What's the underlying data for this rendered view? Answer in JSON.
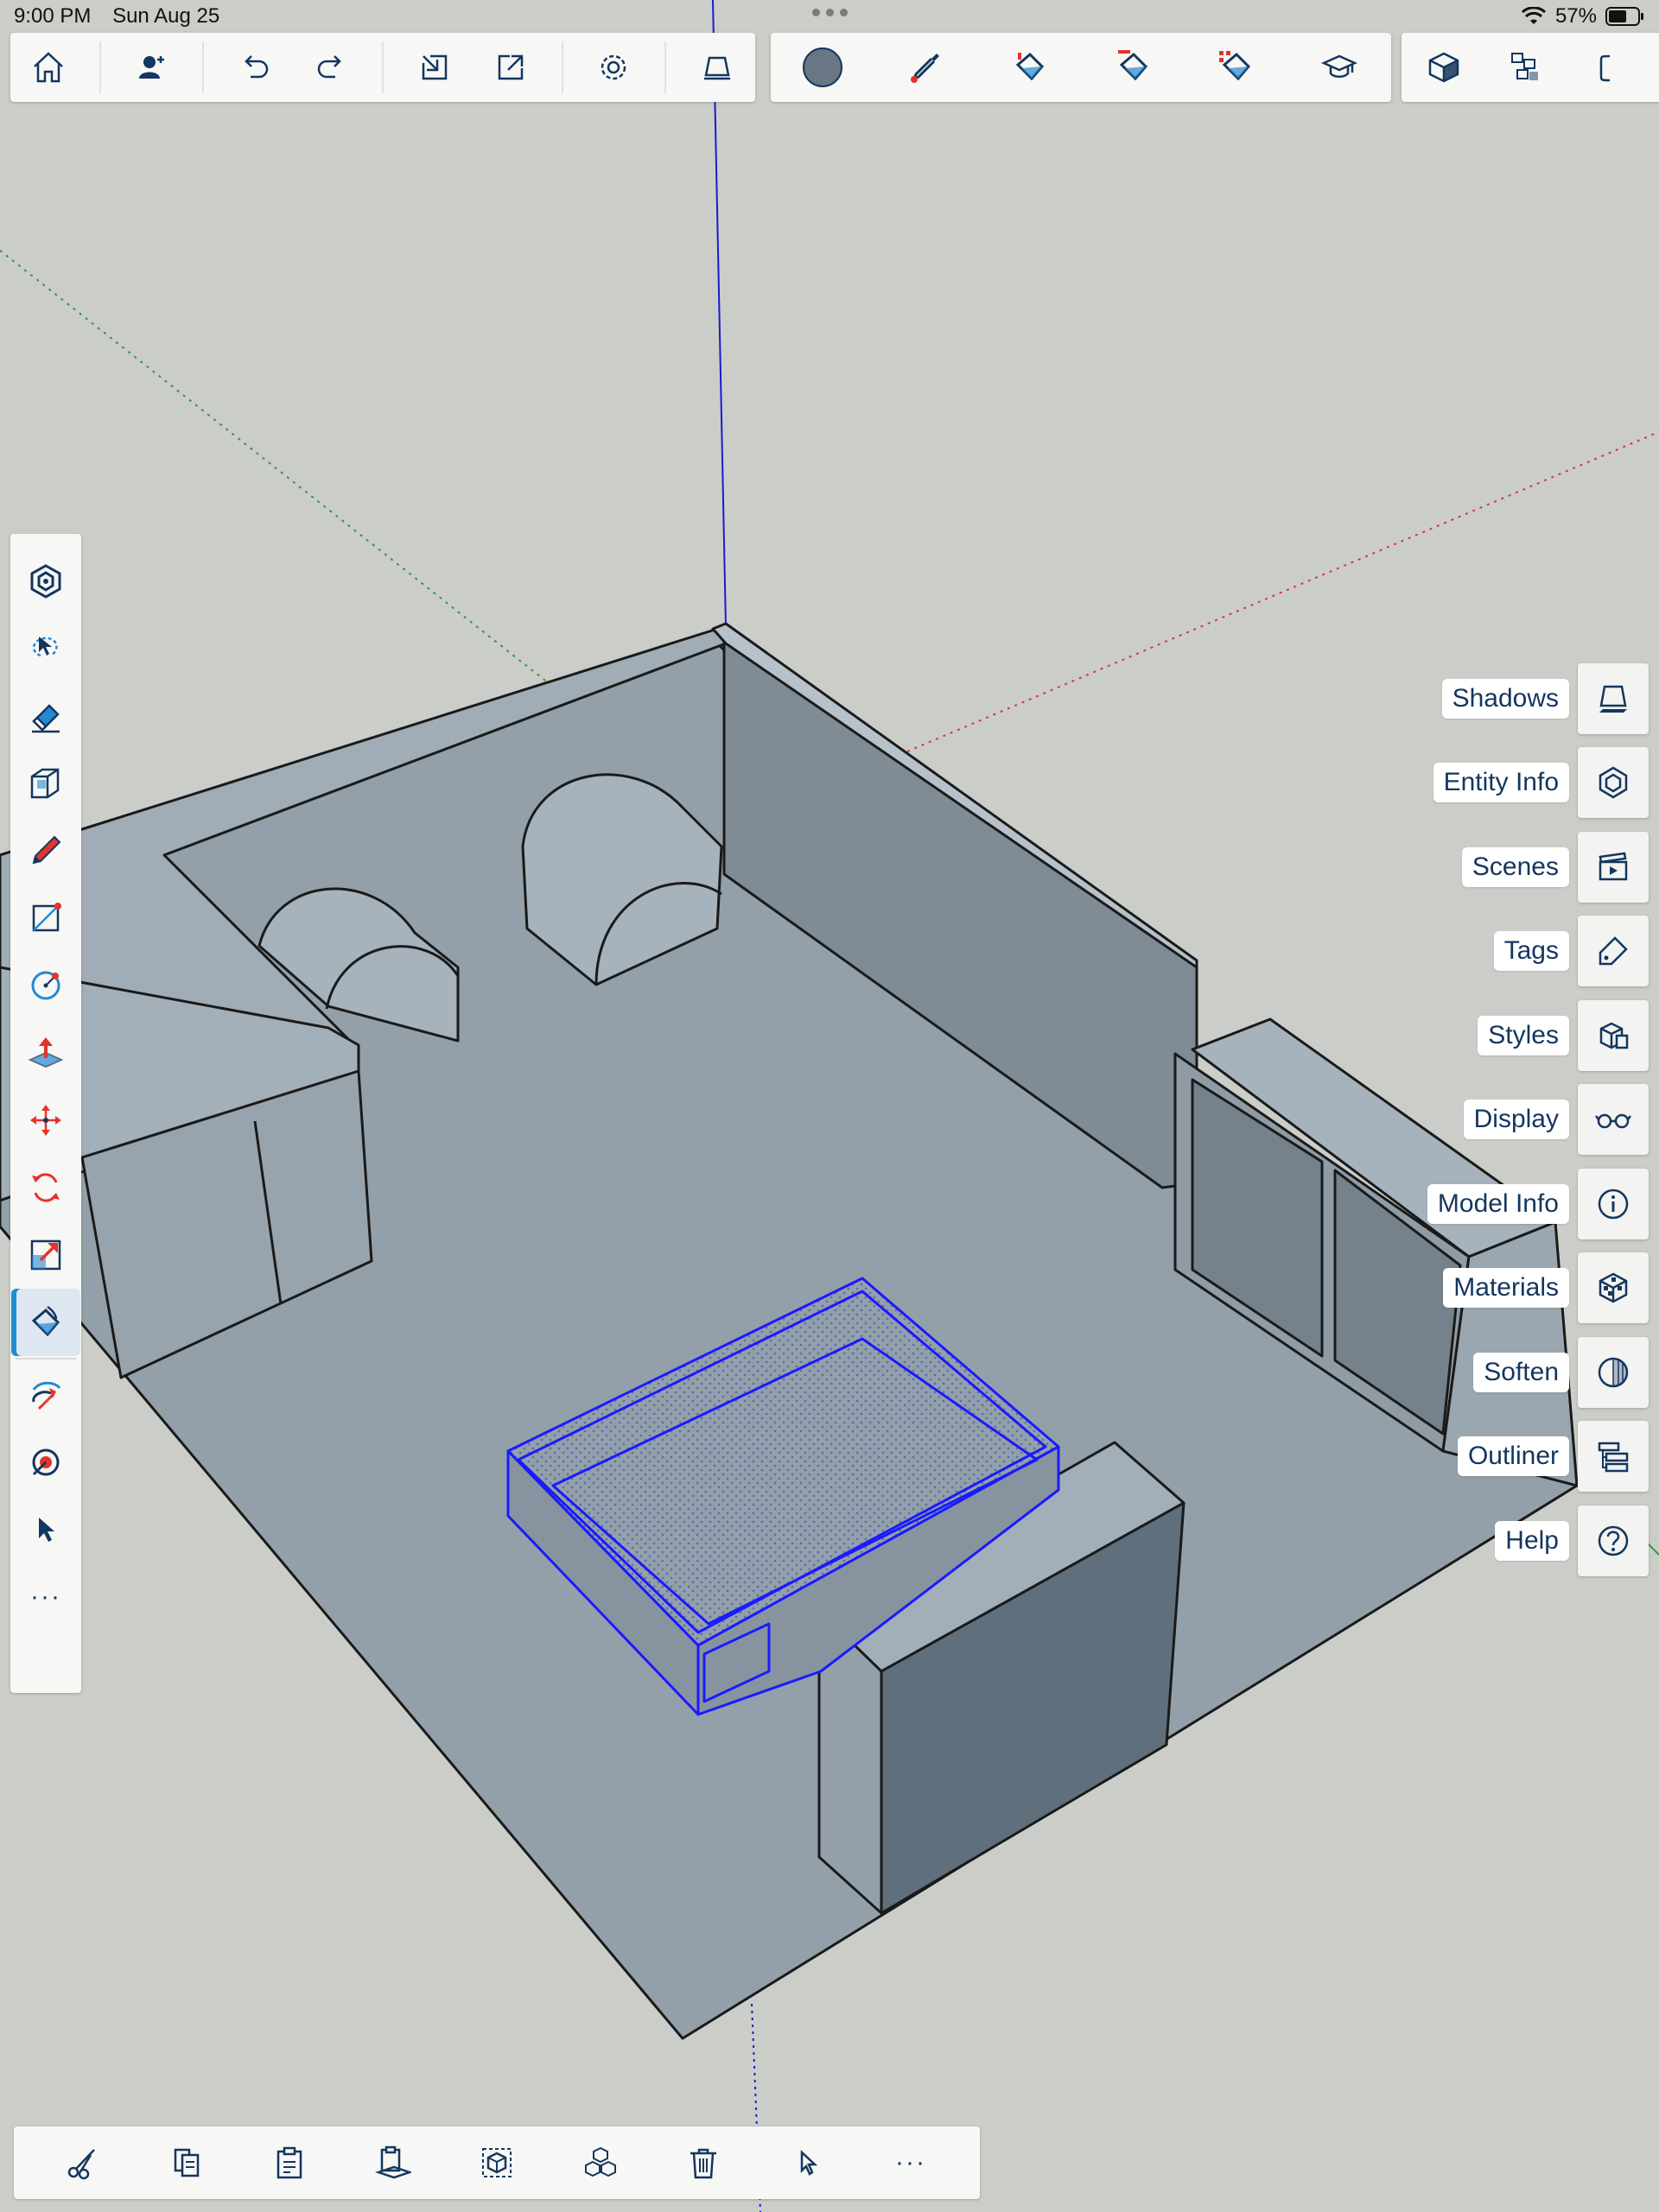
{
  "status_bar": {
    "time": "9:00 PM",
    "date": "Sun Aug 25",
    "battery": "57%"
  },
  "top_toolbar": {
    "left_group": [
      "home-icon",
      "collaborate-icon",
      "undo-icon",
      "redo-icon",
      "import-icon",
      "export-icon",
      "settings-icon",
      "eraser-mode-icon"
    ],
    "middle_group": [
      "color-swatch-icon",
      "eyedropper-icon",
      "paint-bucket-icon",
      "paint-bucket-match-icon",
      "paint-bucket-replace-icon",
      "learn-icon"
    ],
    "right_group": [
      "view-cube-icon",
      "components-icon",
      "panel-icon"
    ],
    "accent_swatch": "#6b7684"
  },
  "left_toolbar": {
    "tools": [
      "object-snap-icon",
      "lasso-select-icon",
      "eraser-icon",
      "solid-tools-icon",
      "pencil-icon",
      "rectangle-icon",
      "circle-icon",
      "push-pull-icon",
      "move-icon",
      "rotate-icon",
      "scale-icon",
      "paint-bucket-icon",
      "orbit-icon",
      "tape-measure-icon",
      "select-icon",
      "more-icon"
    ],
    "active_tool": "paint-bucket-icon",
    "more_label": "···"
  },
  "right_panels": [
    {
      "label": "Shadows",
      "icon": "shadows-icon"
    },
    {
      "label": "Entity Info",
      "icon": "entity-info-icon"
    },
    {
      "label": "Scenes",
      "icon": "scenes-icon"
    },
    {
      "label": "Tags",
      "icon": "tags-icon"
    },
    {
      "label": "Styles",
      "icon": "styles-icon"
    },
    {
      "label": "Display",
      "icon": "display-icon"
    },
    {
      "label": "Model Info",
      "icon": "model-info-icon"
    },
    {
      "label": "Materials",
      "icon": "materials-icon"
    },
    {
      "label": "Soften",
      "icon": "soften-icon"
    },
    {
      "label": "Outliner",
      "icon": "outliner-icon"
    },
    {
      "label": "Help",
      "icon": "help-icon"
    }
  ],
  "bottom_toolbar": {
    "actions": [
      "cut-icon",
      "copy-icon",
      "paste-icon",
      "paste-in-place-icon",
      "select-all-icon",
      "make-component-icon",
      "delete-icon",
      "select-cursor-icon",
      "more-icon"
    ],
    "more_label": "···"
  },
  "colors": {
    "background": "#cbcdc8",
    "model_surface": "#93a0aa",
    "selection": "#1a1aff",
    "axis_red": "#d23a3a",
    "axis_green": "#2d9a3d",
    "axis_blue": "#1b1bcc",
    "toolbar_accent": "#1f8dd6",
    "icon_red": "#e5332a"
  }
}
